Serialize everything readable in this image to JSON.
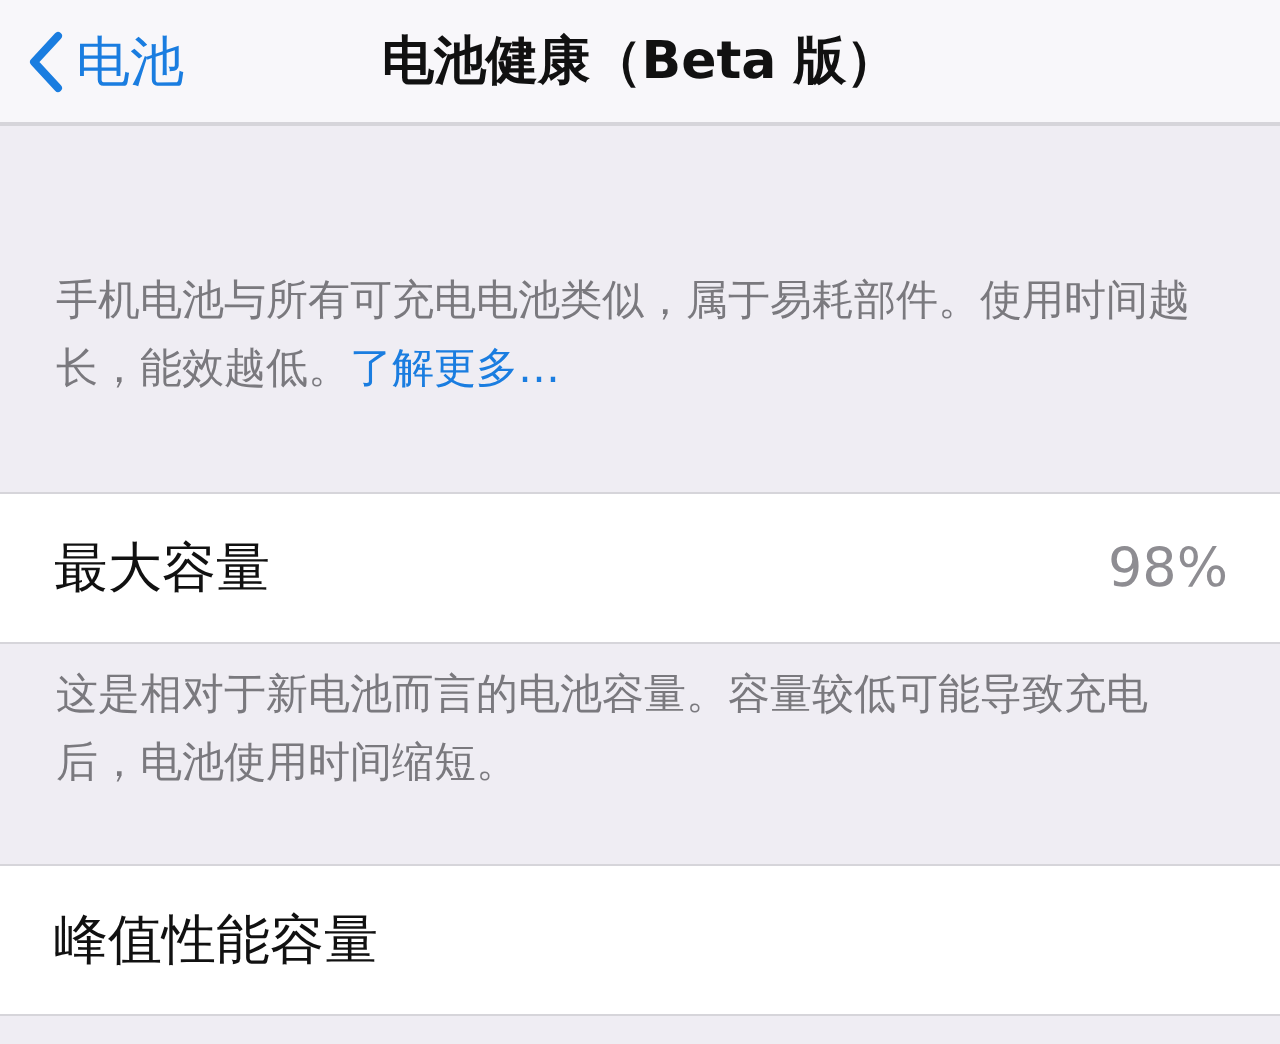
{
  "nav_bar": {
    "back_label": "电池",
    "title": "电池健康（Beta 版）"
  },
  "intro": {
    "text": "手机电池与所有可充电电池类似，属于易耗部件。使用时间越长，能效越低。",
    "link": "了解更多…"
  },
  "sections": [
    {
      "label": "最大容量",
      "value": "98%",
      "footer": "这是相对于新电池而言的电池容量。容量较低可能导致充电后，电池使用时间缩短。"
    },
    {
      "label": "峰值性能容量"
    }
  ]
}
